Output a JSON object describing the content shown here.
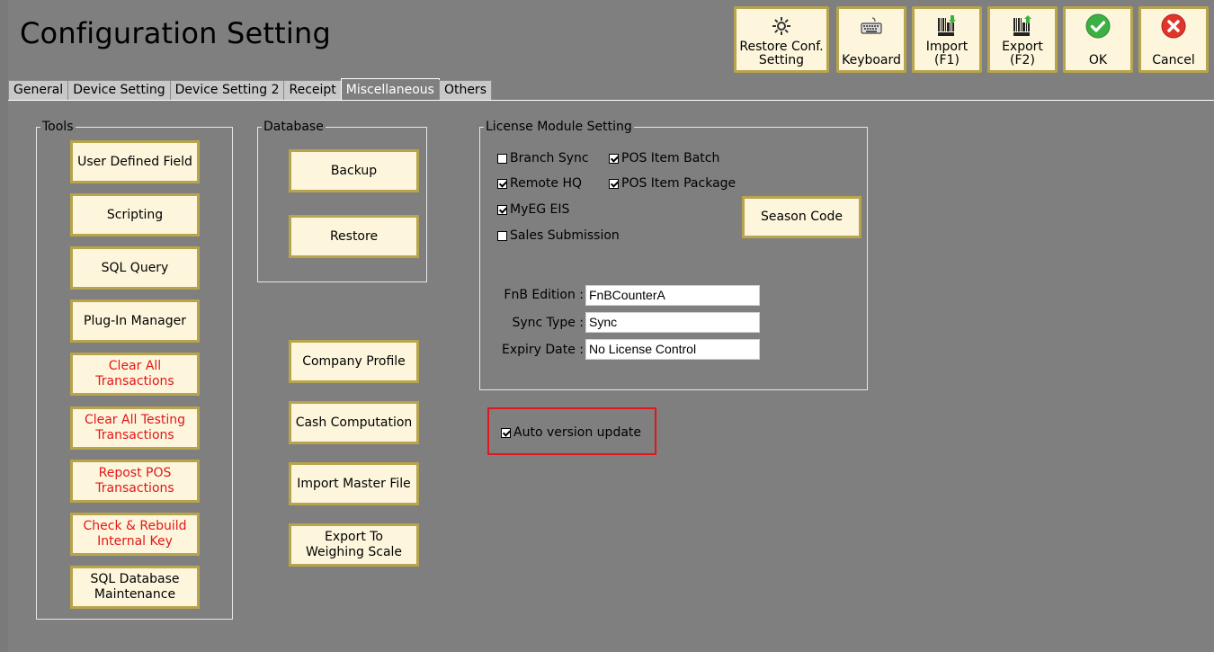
{
  "window": {
    "title": "Configuration Setting"
  },
  "toolbar": {
    "restore": {
      "label": "Restore Conf.\nSetting",
      "icon": "gear-icon"
    },
    "keyboard": {
      "label": "Keyboard",
      "icon": "keyboard-icon"
    },
    "import": {
      "label": "Import\n(F1)",
      "icon": "barcode-import-icon"
    },
    "export": {
      "label": "Export\n(F2)",
      "icon": "barcode-export-icon"
    },
    "ok": {
      "label": "OK",
      "icon": "check-circle-icon",
      "color": "#3cb043"
    },
    "cancel": {
      "label": "Cancel",
      "icon": "close-circle-icon",
      "color": "#e0352b"
    }
  },
  "tabs": [
    "General",
    "Device Setting",
    "Device Setting 2",
    "Receipt",
    "Miscellaneous",
    "Others"
  ],
  "active_tab": "Miscellaneous",
  "tools": {
    "title": "Tools",
    "buttons": [
      {
        "label": "User Defined Field",
        "danger": false
      },
      {
        "label": "Scripting",
        "danger": false
      },
      {
        "label": "SQL Query",
        "danger": false
      },
      {
        "label": "Plug-In Manager",
        "danger": false
      },
      {
        "label": "Clear All\nTransactions",
        "danger": true
      },
      {
        "label": "Clear All Testing\nTransactions",
        "danger": true
      },
      {
        "label": "Repost POS\nTransactions",
        "danger": true
      },
      {
        "label": "Check & Rebuild\nInternal Key",
        "danger": true
      },
      {
        "label": "SQL Database\nMaintenance",
        "danger": false
      }
    ]
  },
  "database": {
    "title": "Database",
    "backup": "Backup",
    "restore": "Restore"
  },
  "misc_buttons": {
    "company_profile": "Company Profile",
    "cash_computation": "Cash Computation",
    "import_master": "Import Master File",
    "export_weighing": "Export To\nWeighing Scale"
  },
  "license": {
    "title": "License Module Setting",
    "branch_sync": {
      "label": "Branch Sync",
      "checked": false
    },
    "pos_item_batch": {
      "label": "POS Item Batch",
      "checked": true
    },
    "remote_hq": {
      "label": "Remote HQ",
      "checked": true
    },
    "pos_item_package": {
      "label": "POS Item Package",
      "checked": true
    },
    "myeg_eis": {
      "label": "MyEG EIS",
      "checked": true
    },
    "sales_submission": {
      "label": "Sales Submission",
      "checked": false
    },
    "season_code": "Season Code",
    "fnb_edition": {
      "label": "FnB Edition :",
      "value": "FnBCounterA"
    },
    "sync_type": {
      "label": "Sync Type :",
      "value": "Sync"
    },
    "expiry_date": {
      "label": "Expiry Date :",
      "value": "No License Control"
    }
  },
  "auto_update": {
    "label": "Auto version update",
    "checked": true,
    "highlight_color": "#e3161b"
  }
}
